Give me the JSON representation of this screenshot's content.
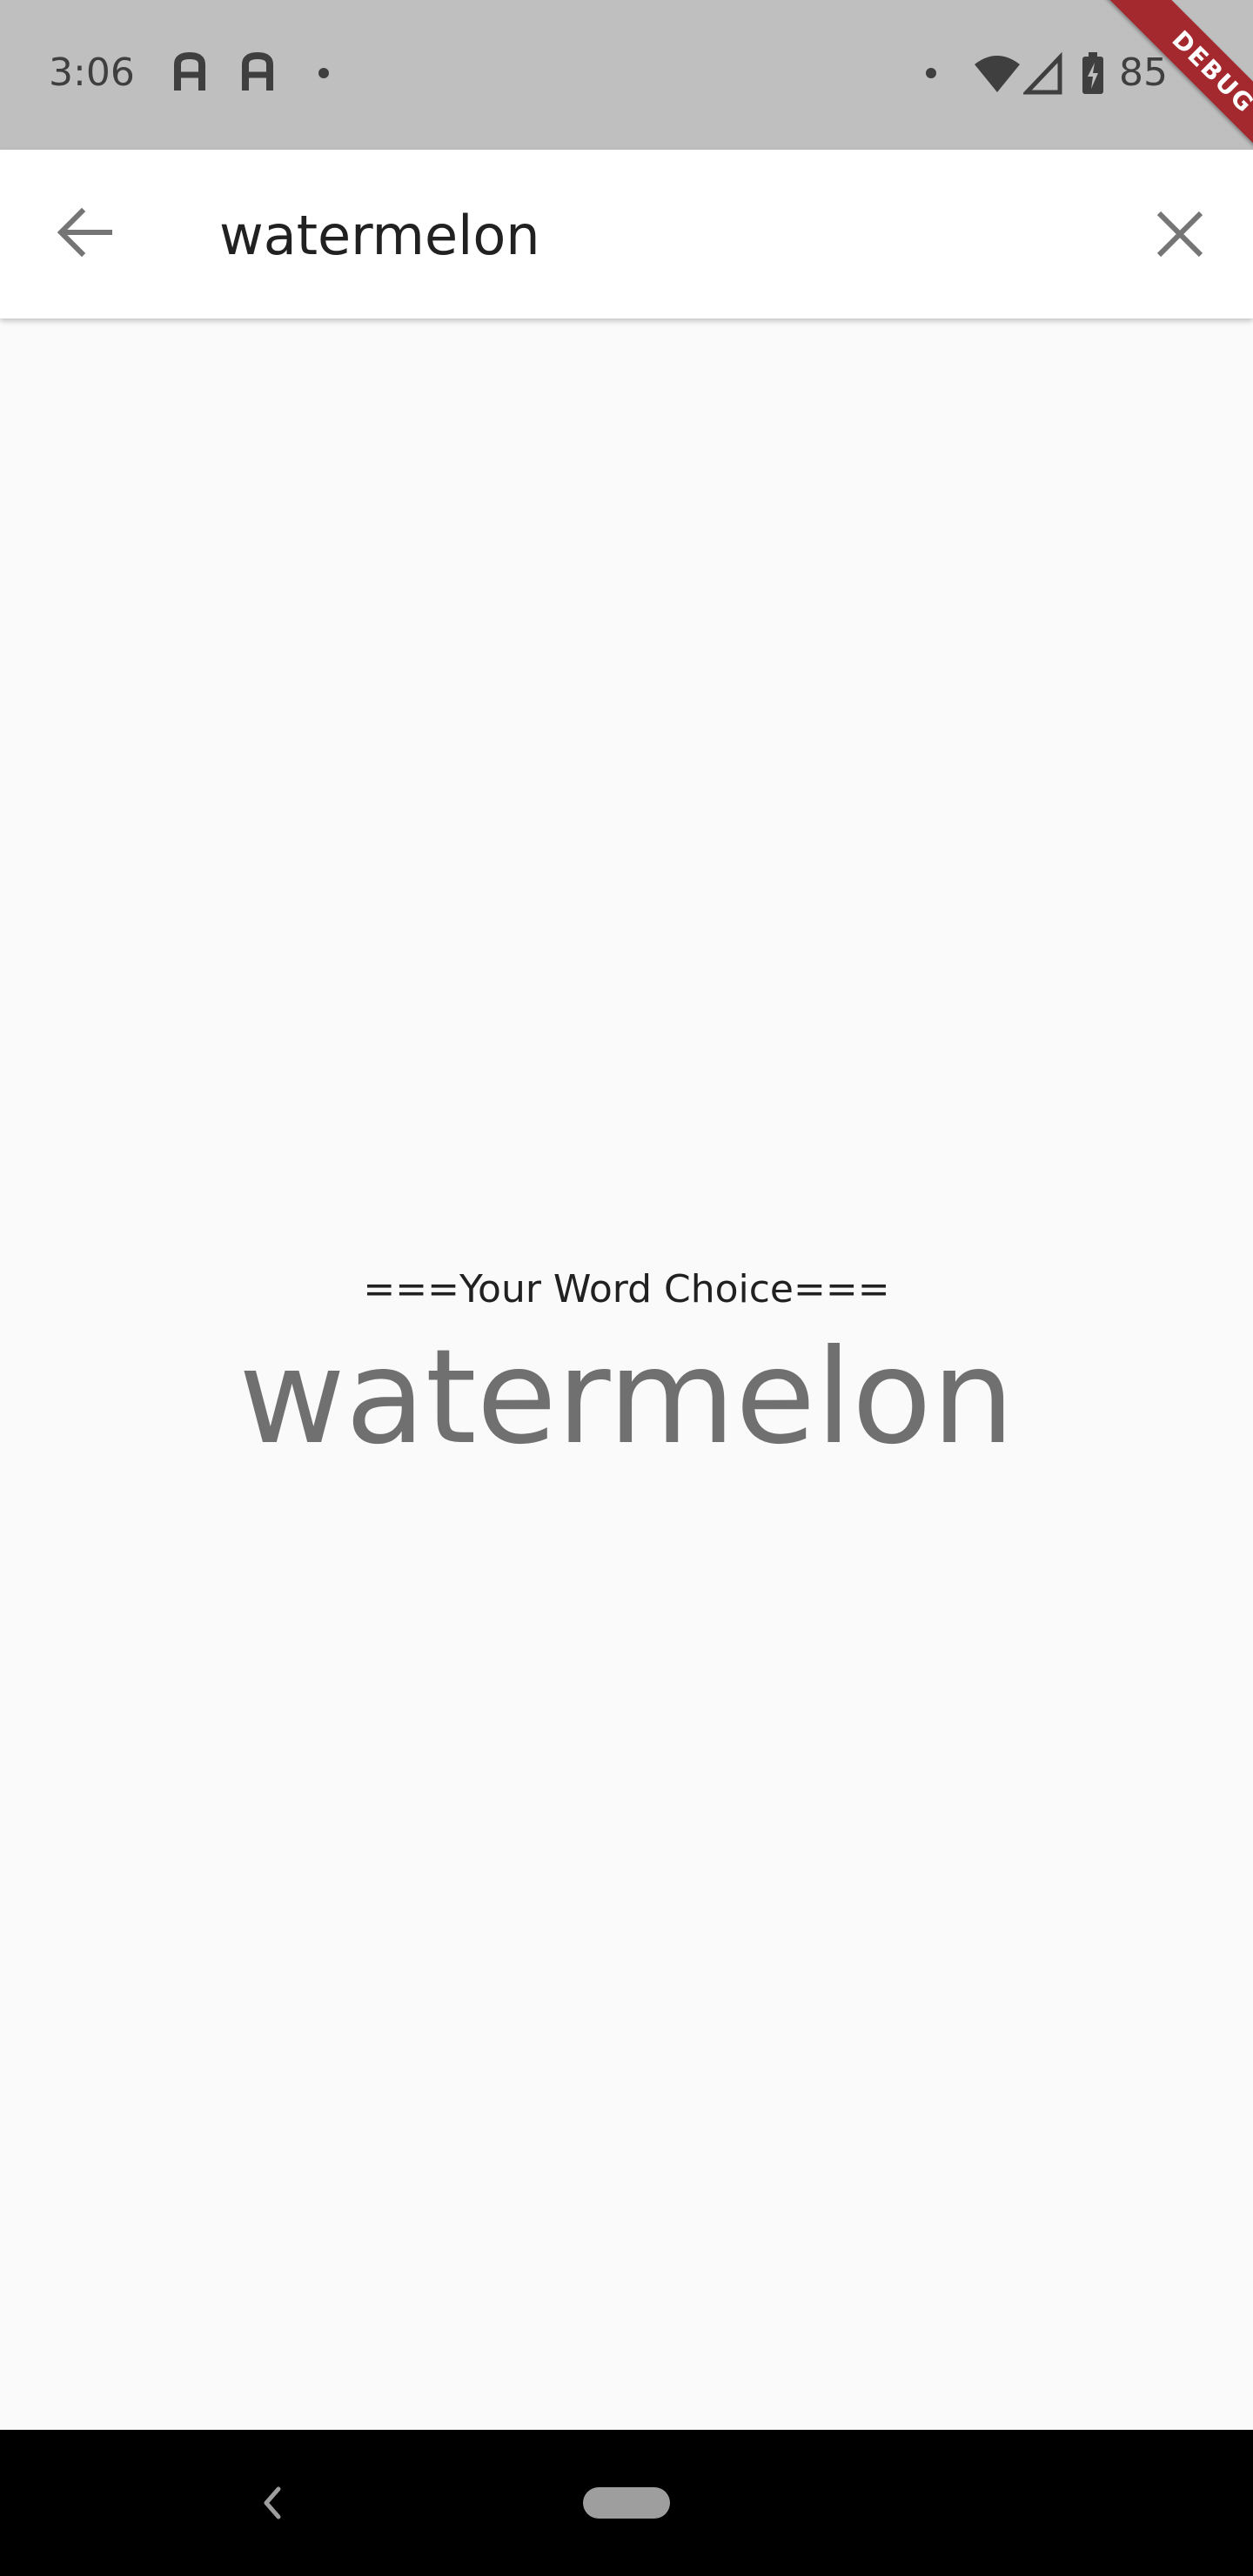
{
  "status_bar": {
    "time": "3:06",
    "battery": "85",
    "left_icons": [
      "a-notification-icon",
      "a-notification-icon",
      "dot-icon"
    ],
    "right_icons": [
      "dot-icon",
      "wifi-icon",
      "signal-icon",
      "battery-charging-icon"
    ]
  },
  "debug_banner": "DEBUG",
  "app_bar": {
    "search_value": "watermelon",
    "back_icon": "arrow-back-icon",
    "clear_icon": "close-icon"
  },
  "content": {
    "heading": "===Your Word Choice===",
    "word": "watermelon"
  },
  "navigation_bar": {
    "back_icon": "nav-back-icon",
    "home_icon": "home-pill-icon"
  },
  "colors": {
    "status_bar_bg": "#bfbfbf",
    "app_bar_bg": "#ffffff",
    "page_bg": "#fafafa",
    "word_color": "#707070",
    "debug_ribbon": "#a4292f",
    "nav_bar_bg": "#000000"
  }
}
